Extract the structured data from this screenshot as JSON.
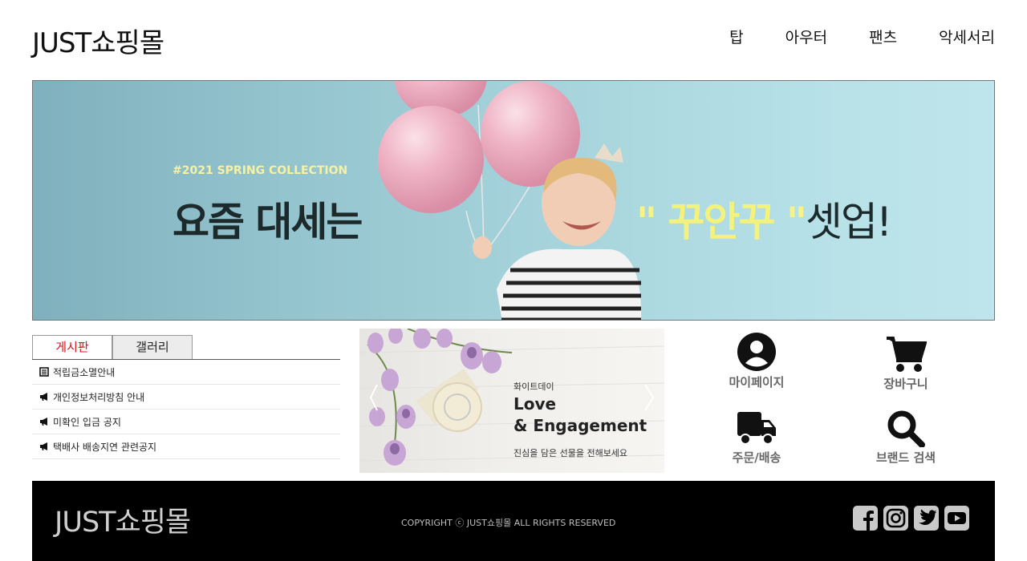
{
  "header": {
    "logo": "JUST쇼핑몰",
    "nav": [
      "탑",
      "아우터",
      "팬츠",
      "악세서리"
    ]
  },
  "banner": {
    "tag": "#2021 SPRING COLLECTION",
    "headline_left": "요즘 대세는",
    "headline_quote_open": "\"",
    "headline_word": " 꾸안꾸 ",
    "headline_quote_close": "\"",
    "headline_end": "셋업!"
  },
  "board": {
    "tabs": [
      "게시판",
      "갤러리"
    ],
    "items": [
      {
        "icon": "list-icon",
        "text": "적립금소멸안내"
      },
      {
        "icon": "megaphone-icon",
        "text": "개인정보처리방침 안내"
      },
      {
        "icon": "megaphone-icon",
        "text": "미확인 입금 공지"
      },
      {
        "icon": "megaphone-icon",
        "text": "택배사 배송지연 관련공지"
      }
    ]
  },
  "promo": {
    "sub": "화이트데이",
    "title1": "Love",
    "title2": "&  Engagement",
    "desc": "진심을 담은 선물을 전해보세요"
  },
  "quick": {
    "mypage": "마이페이지",
    "cart": "장바구니",
    "order": "주문/배송",
    "search": "브랜드 검색"
  },
  "footer": {
    "logo": "JUST쇼핑몰",
    "copyright": "COPYRIGHT ⓒ JUST쇼핑몰 ALL RIGHTS RESERVED",
    "socials": [
      "facebook-icon",
      "instagram-icon",
      "twitter-icon",
      "youtube-icon"
    ]
  },
  "colors": {
    "accent_red": "#d8141b",
    "banner_bg": "#a7d4dc",
    "banner_highlight": "#f3f27c",
    "footer_bg": "#000000"
  }
}
